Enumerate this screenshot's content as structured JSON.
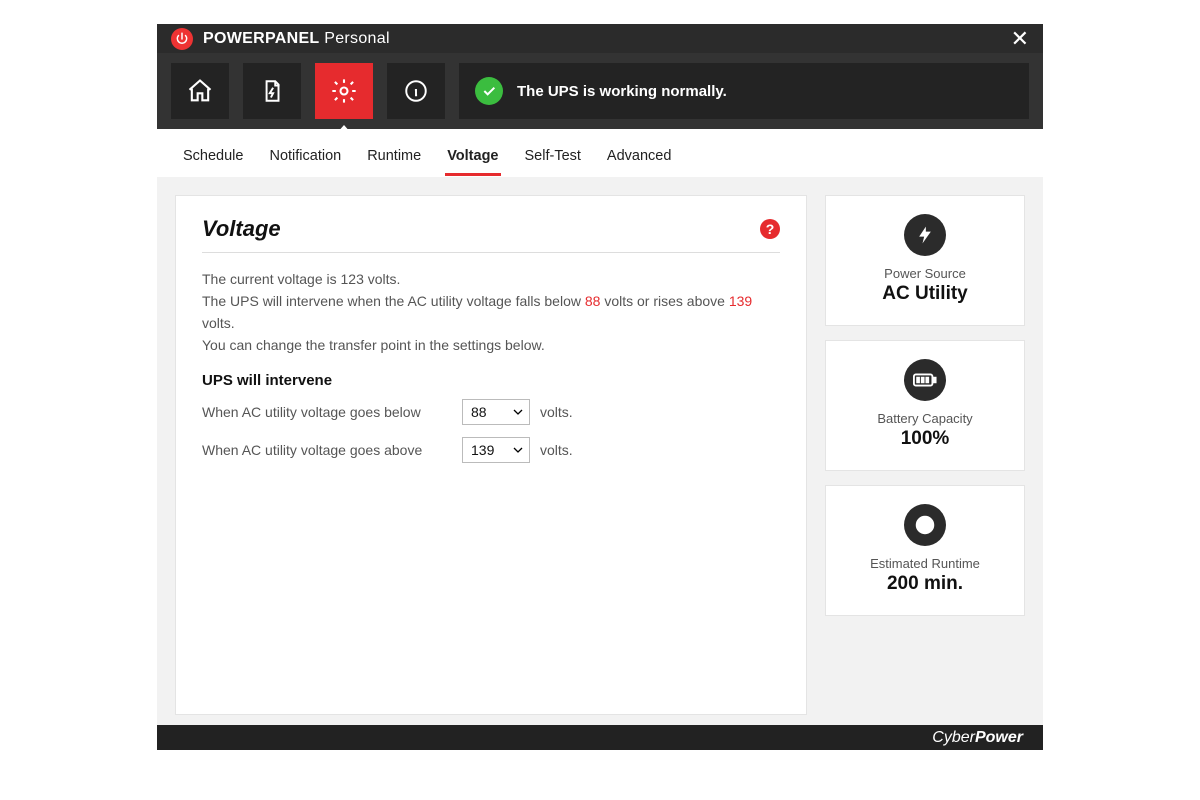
{
  "app": {
    "brand_bold": "POWER",
    "brand_bold2": "PANEL",
    "brand_thin": "Personal"
  },
  "nav": {
    "items": [
      {
        "name": "home-icon"
      },
      {
        "name": "document-bolt-icon"
      },
      {
        "name": "gear-icon",
        "active": true
      },
      {
        "name": "info-icon"
      }
    ]
  },
  "status": {
    "text": "The UPS is working normally."
  },
  "tabs": [
    "Schedule",
    "Notification",
    "Runtime",
    "Voltage",
    "Self-Test",
    "Advanced"
  ],
  "active_tab": "Voltage",
  "voltage": {
    "title": "Voltage",
    "desc_line1_a": "The current voltage is ",
    "current_volts": "123",
    "desc_line1_b": " volts.",
    "desc_line2_a": "The UPS will intervene when the AC utility voltage falls below ",
    "low_threshold": "88",
    "desc_line2_b": " volts or rises above ",
    "high_threshold": "139",
    "desc_line2_c": " volts.",
    "desc_line3": "You can change the transfer point in the settings below.",
    "sub_heading": "UPS will intervene",
    "row_low_label": "When AC utility voltage goes below",
    "row_high_label": "When AC utility voltage goes above",
    "unit": "volts.",
    "select_low": "88",
    "select_high": "139"
  },
  "side": {
    "power_source": {
      "label": "Power Source",
      "value": "AC Utility"
    },
    "battery": {
      "label": "Battery Capacity",
      "value": "100%"
    },
    "runtime": {
      "label": "Estimated Runtime",
      "value": "200 min."
    }
  },
  "footer": {
    "a": "Cyber",
    "b": "Power"
  }
}
